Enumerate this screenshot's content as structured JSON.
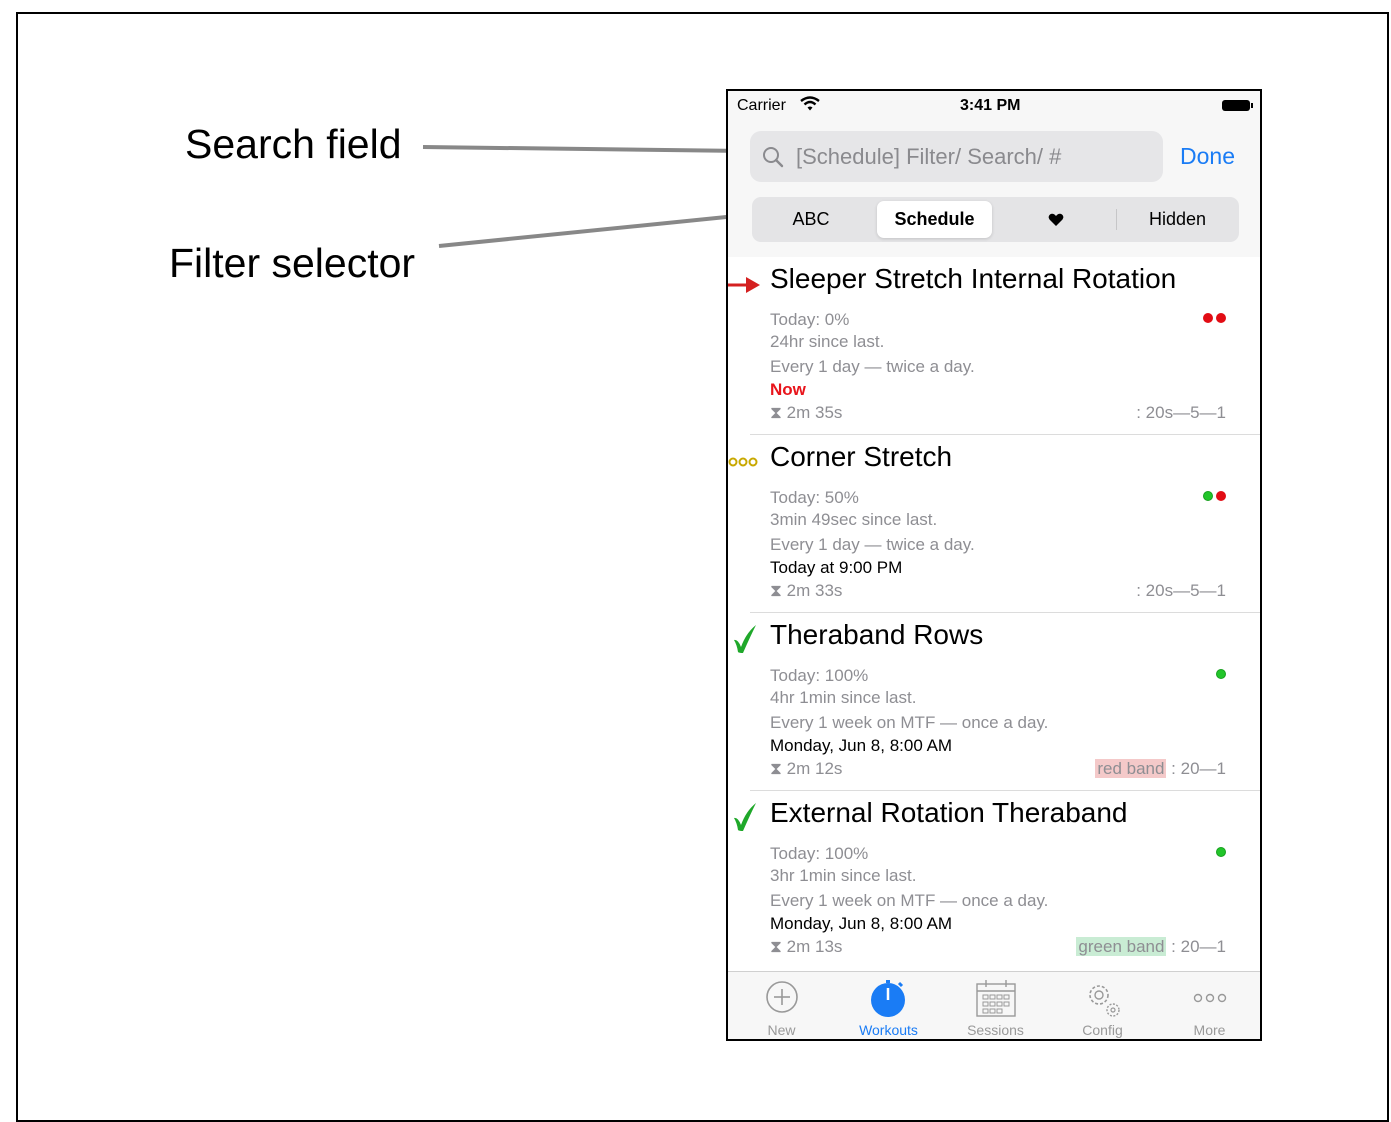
{
  "callouts": {
    "search": "Search field",
    "filter": "Filter selector"
  },
  "status_bar": {
    "carrier": "Carrier",
    "time": "3:41 PM"
  },
  "search": {
    "placeholder": "[Schedule] Filter/ Search/ #",
    "done_label": "Done"
  },
  "filter_segments": {
    "abc": "ABC",
    "schedule": "Schedule",
    "favorite_icon": "heart-icon",
    "hidden": "Hidden",
    "selected": "Schedule"
  },
  "workouts": [
    {
      "title": "Sleeper Stretch Internal Rotation",
      "today": "Today: 0%",
      "since": "24hr since last.",
      "frequency": "Every 1 day  — twice a day.",
      "due": "Now",
      "duration": "⧗ 2m 35s",
      "band": "",
      "reps": ": 20s—5—1",
      "status_dots": [
        "red",
        "red"
      ],
      "marker": "arrow"
    },
    {
      "title": "Corner Stretch",
      "today": "Today: 50%",
      "since": "3min 49sec since last.",
      "frequency": "Every 1 day  — twice a day.",
      "due": "Today at 9:00 PM",
      "duration": "⧗ 2m 33s",
      "band": "",
      "reps": ": 20s—5—1",
      "status_dots": [
        "green",
        "red"
      ],
      "marker": "ellipsis"
    },
    {
      "title": "Theraband Rows",
      "today": "Today: 100%",
      "since": "4hr 1min since last.",
      "frequency": "Every 1 week on MTF — once a day.",
      "due": "Monday, Jun 8, 8:00 AM",
      "duration": "⧗ 2m 12s",
      "band": "red band",
      "reps": " : 20—1",
      "status_dots": [
        "green"
      ],
      "marker": "check"
    },
    {
      "title": "External Rotation Theraband",
      "today": "Today: 100%",
      "since": "3hr 1min since last.",
      "frequency": "Every 1 week on MTF — once a day.",
      "due": "Monday, Jun 8, 8:00 AM",
      "duration": "⧗ 2m 13s",
      "band": "green band",
      "reps": " : 20—1",
      "status_dots": [
        "green"
      ],
      "marker": "check"
    }
  ],
  "tabs": [
    {
      "label": "New",
      "icon": "plus-circle-icon"
    },
    {
      "label": "Workouts",
      "icon": "stopwatch-icon",
      "active": true
    },
    {
      "label": "Sessions",
      "icon": "calendar-icon"
    },
    {
      "label": "Config",
      "icon": "gears-icon"
    },
    {
      "label": "More",
      "icon": "more-dots-icon"
    }
  ],
  "colors": {
    "accent": "#1a7cf5",
    "due_now": "#e8141b",
    "red_band_bg": "#f4c9c9",
    "green_band_bg": "#c9ecd4",
    "check_green": "#1fa82a"
  }
}
